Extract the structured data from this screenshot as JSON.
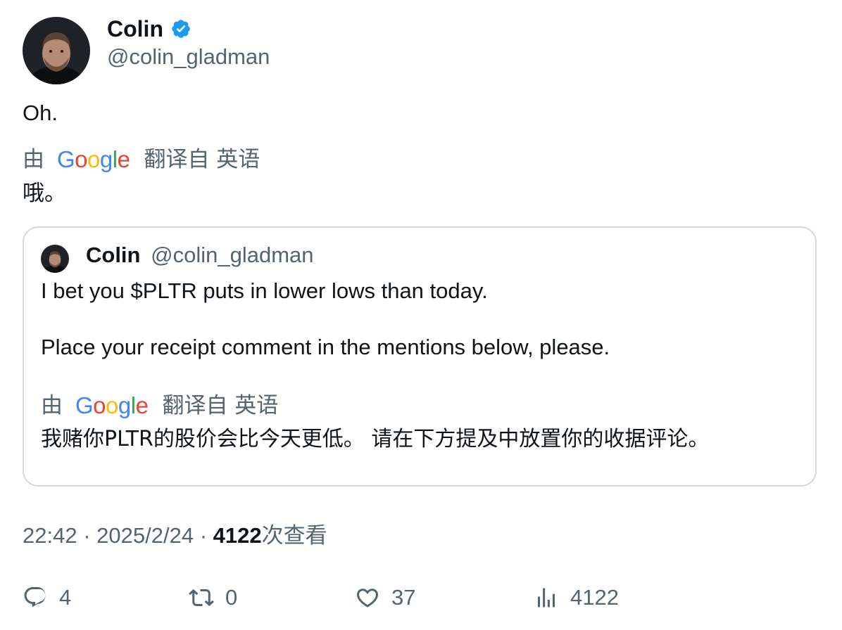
{
  "author": {
    "name": "Colin",
    "handle": "@colin_gladman",
    "verified_color": "#1d9bf0"
  },
  "tweet": {
    "text": "Oh.",
    "translation": {
      "by": "由",
      "provider": "Google",
      "from": "翻译自 英语",
      "text": "哦。"
    }
  },
  "quoted_tweet": {
    "name": "Colin",
    "handle": "@colin_gladman",
    "paragraphs": [
      "I bet you $PLTR puts in lower lows than today.",
      "Place your receipt comment in the mentions below, please."
    ],
    "translation": {
      "by": "由",
      "provider": "Google",
      "from": "翻译自 英语",
      "text": "我赌你PLTR的股价会比今天更低。 请在下方提及中放置你的收据评论。"
    }
  },
  "meta": {
    "time": "22:42",
    "separator": "·",
    "date": "2025/2/24",
    "views_count": "4122",
    "views_label": "次查看"
  },
  "actions": {
    "replies": "4",
    "reposts": "0",
    "likes": "37",
    "views": "4122"
  },
  "icons": [
    "verified-badge-icon",
    "reply-icon",
    "repost-icon",
    "like-icon",
    "views-icon"
  ]
}
